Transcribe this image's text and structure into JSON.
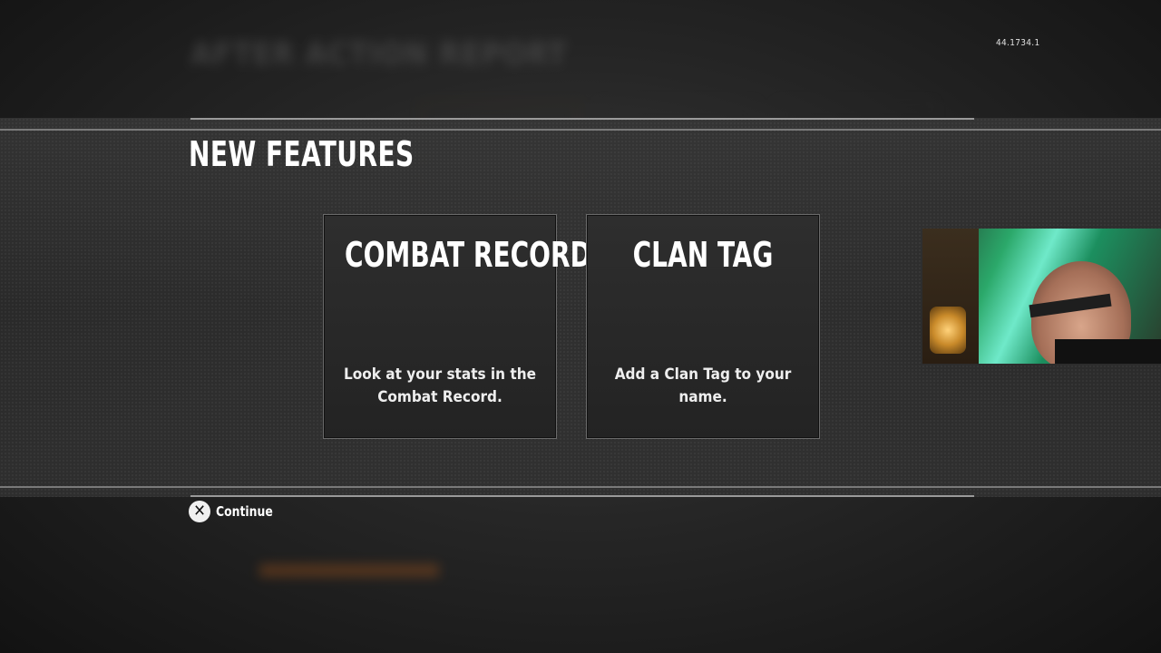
{
  "version": "44.1734.1",
  "modal": {
    "title": "NEW FEATURES",
    "cards": [
      {
        "title": "COMBAT RECORD",
        "description": "Look at your stats in the Combat Record."
      },
      {
        "title": "CLAN TAG",
        "description": "Add a Clan Tag to your name."
      }
    ],
    "continue": {
      "button_icon": "cross-button-icon",
      "label": "Continue"
    }
  },
  "background": {
    "title": "AFTER ACTION REPORT",
    "accent_color": "#c0601a"
  },
  "colors": {
    "accent": "#c0601a",
    "text": "#ffffff"
  }
}
